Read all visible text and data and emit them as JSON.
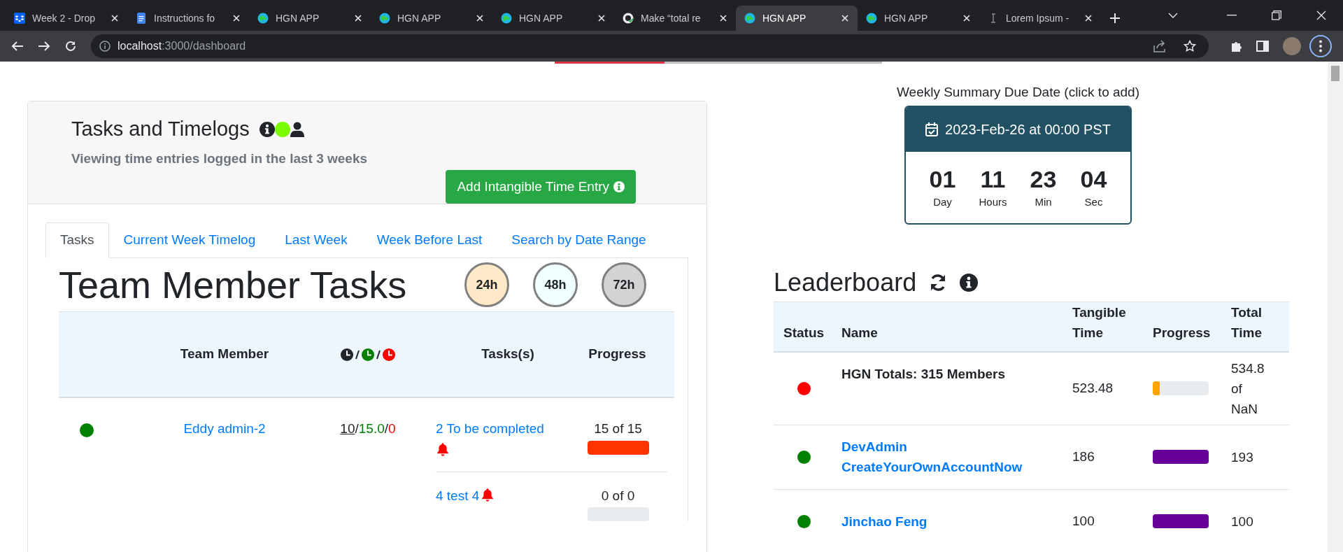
{
  "browser": {
    "tabs": [
      {
        "title": "Week 2 - Drop",
        "kind": "dropbox",
        "selected": false
      },
      {
        "title": "Instructions fo",
        "kind": "docs",
        "selected": false
      },
      {
        "title": "HGN APP",
        "kind": "hgn",
        "selected": false
      },
      {
        "title": "HGN APP",
        "kind": "hgn",
        "selected": false
      },
      {
        "title": "HGN APP",
        "kind": "hgn",
        "selected": false
      },
      {
        "title": "Make “total re",
        "kind": "github",
        "selected": false
      },
      {
        "title": "HGN APP",
        "kind": "hgn",
        "selected": true
      },
      {
        "title": "HGN APP",
        "kind": "hgn",
        "selected": false
      },
      {
        "title": "Lorem Ipsum -",
        "kind": "lorem",
        "selected": false
      }
    ],
    "address": {
      "host": "localhost",
      "path": ":3000/dashboard"
    }
  },
  "tasks_panel": {
    "title": "Tasks and Timelogs",
    "subtitle": "Viewing time entries logged in the last 3 weeks",
    "add_button": "Add Intangible Time Entry",
    "tabs": [
      {
        "label": "Tasks",
        "selected": true
      },
      {
        "label": "Current Week Timelog",
        "selected": false
      },
      {
        "label": "Last Week",
        "selected": false
      },
      {
        "label": "Week Before Last",
        "selected": false
      },
      {
        "label": "Search by Date Range",
        "selected": false
      }
    ],
    "section_title": "Team Member Tasks",
    "time_filters": [
      {
        "label": "24h",
        "color": "#ffe9c6"
      },
      {
        "label": "48h",
        "color": "#f0ffff"
      },
      {
        "label": "72h",
        "color": "#d3d3d3"
      }
    ],
    "table": {
      "columns": [
        {
          "kind": "blank"
        },
        {
          "kind": "text",
          "label": "Team Member"
        },
        {
          "kind": "clocks"
        },
        {
          "kind": "text",
          "label": "Tasks(s)"
        },
        {
          "kind": "text",
          "label": "Progress"
        }
      ],
      "rows": [
        {
          "color": "#008000",
          "member": "Eddy admin-2",
          "hours": [
            {
              "kind": "committed",
              "text": "10"
            },
            {
              "kind": "separator",
              "text": "/"
            },
            {
              "kind": "logged",
              "text": "15.0"
            },
            {
              "kind": "separator",
              "text": "/"
            },
            {
              "kind": "remaining",
              "text": "0"
            }
          ],
          "tasks": [
            {
              "label": "2 To be completed",
              "alert": true,
              "progress": "15 of 15",
              "level": 1
            },
            {
              "label": "4 test 4",
              "alert": true,
              "progress": "0 of 0",
              "level": 0
            }
          ]
        }
      ]
    }
  },
  "due_date": {
    "caption": "Weekly Summary Due Date (click to add)",
    "date": "2023-Feb-26 at 00:00 PST",
    "units": [
      {
        "value": "01",
        "label": "Day"
      },
      {
        "value": "11",
        "label": "Hours"
      },
      {
        "value": "23",
        "label": "Min"
      },
      {
        "value": "04",
        "label": "Sec"
      }
    ]
  },
  "leaderboard": {
    "title": "Leaderboard",
    "columns": [
      "Status",
      "Name",
      "Tangible Time",
      "Progress",
      "Total Time"
    ],
    "rows": [
      {
        "kind": "total",
        "color": "#ff0000",
        "name": "HGN Totals: 315 Members",
        "tangible": "523.48",
        "level": 0.12,
        "total": "534.8 of NaN"
      },
      {
        "kind": "member",
        "color": "#008000",
        "name": "DevAdmin CreateYourOwnAccountNow",
        "tangible": "186",
        "level": 1,
        "total": "193"
      },
      {
        "kind": "member",
        "color": "#008000",
        "name": "Jinchao Feng",
        "tangible": "100",
        "level": 1,
        "total": "100"
      }
    ]
  }
}
